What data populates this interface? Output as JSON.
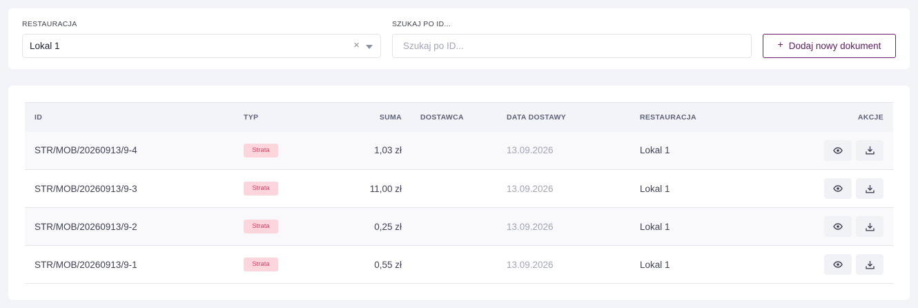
{
  "filters": {
    "restaurant_label": "RESTAURACJA",
    "restaurant_value": "Lokal 1",
    "clear_symbol": "×",
    "search_label": "SZUKAJ PO ID...",
    "search_placeholder": "Szukaj po ID...",
    "add_plus": "+",
    "add_button": "Dodaj nowy dokument"
  },
  "table": {
    "headers": {
      "id": "ID",
      "typ": "TYP",
      "suma": "SUMA",
      "dostawca": "DOSTAWCA",
      "data": "DATA DOSTAWY",
      "restauracja": "RESTAURACJA",
      "akcje": "AKCJE"
    },
    "rows": [
      {
        "id": "STR/MOB/20260913/9-4",
        "typ": "Strata",
        "suma": "1,03 zł",
        "dostawca": "",
        "data": "13.09.2026",
        "restauracja": "Lokal 1"
      },
      {
        "id": "STR/MOB/20260913/9-3",
        "typ": "Strata",
        "suma": "11,00 zł",
        "dostawca": "",
        "data": "13.09.2026",
        "restauracja": "Lokal 1"
      },
      {
        "id": "STR/MOB/20260913/9-2",
        "typ": "Strata",
        "suma": "0,25 zł",
        "dostawca": "",
        "data": "13.09.2026",
        "restauracja": "Lokal 1"
      },
      {
        "id": "STR/MOB/20260913/9-1",
        "typ": "Strata",
        "suma": "0,55 zł",
        "dostawca": "",
        "data": "13.09.2026",
        "restauracja": "Lokal 1"
      }
    ],
    "row_actions": [
      "eye-icon",
      "download-icon"
    ]
  },
  "colors": {
    "brand": "#5b1a5e",
    "badge_bg": "#fcd5dd",
    "badge_text": "#e23d61",
    "muted": "#a1a5b7"
  }
}
